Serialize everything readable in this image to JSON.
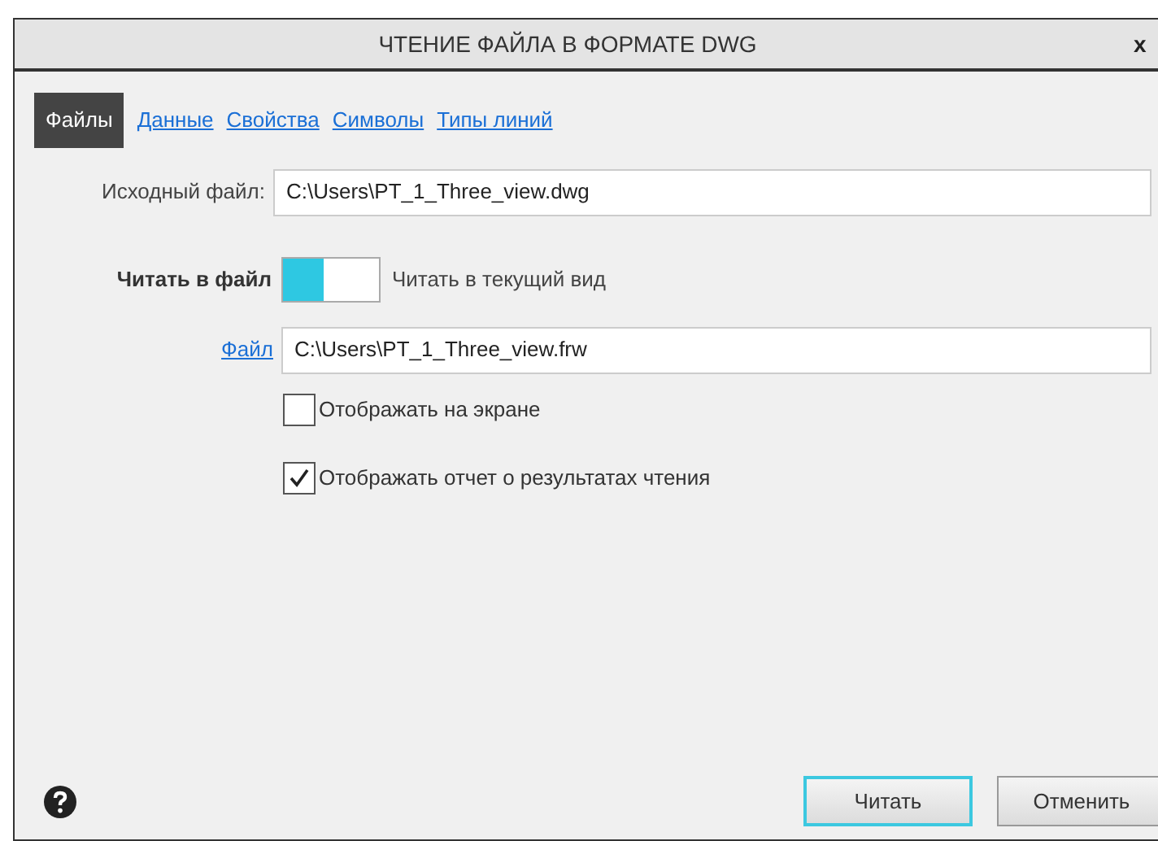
{
  "window": {
    "title": "ЧТЕНИЕ ФАЙЛА В ФОРМАТЕ DWG",
    "close": "x"
  },
  "tabs": [
    {
      "label": "Файлы",
      "selected": true
    },
    {
      "label": "Данные",
      "selected": false
    },
    {
      "label": "Свойства",
      "selected": false
    },
    {
      "label": "Символы",
      "selected": false
    },
    {
      "label": "Типы линий",
      "selected": false
    }
  ],
  "source": {
    "label": "Исходный файл:",
    "value": "C:\\Users\\PT_1_Three_view.dwg"
  },
  "read_mode": {
    "left_label": "Читать в файл",
    "right_label": "Читать в текущий вид",
    "read_to_view": false
  },
  "target": {
    "link": "Файл",
    "value": "C:\\Users\\PT_1_Three_view.frw"
  },
  "options": [
    {
      "label": "Отображать на экране",
      "checked": false
    },
    {
      "label": "Отображать отчет о результатах чтения",
      "checked": true
    }
  ],
  "buttons": [
    {
      "label": "Читать",
      "default": true
    },
    {
      "label": "Отменить",
      "default": false
    }
  ]
}
